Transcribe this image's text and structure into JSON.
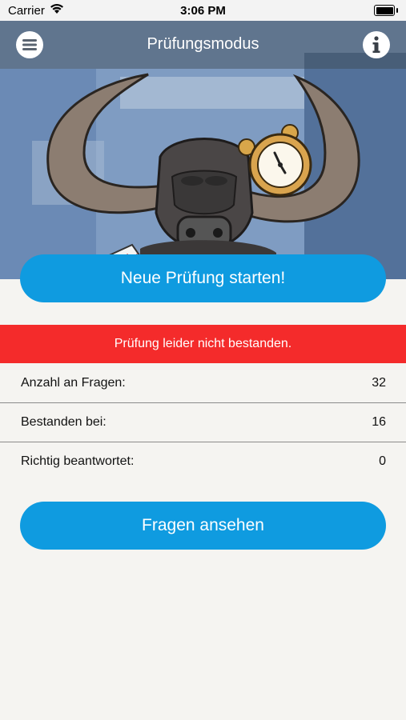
{
  "status_bar": {
    "carrier": "Carrier",
    "time": "3:06 PM"
  },
  "nav": {
    "title": "Prüfungsmodus",
    "menu_icon": "menu-icon",
    "info_icon": "info-icon"
  },
  "hero": {
    "illustration": "bull-mascot-with-alarm-clock"
  },
  "actions": {
    "start_label": "Neue Prüfung starten!",
    "view_label": "Fragen ansehen"
  },
  "result": {
    "message": "Prüfung leider nicht bestanden.",
    "color": "#f42b2b"
  },
  "stats": [
    {
      "label": "Anzahl an Fragen:",
      "value": "32"
    },
    {
      "label": "Bestanden bei:",
      "value": "16"
    },
    {
      "label": "Richtig beantwortet:",
      "value": "0"
    }
  ],
  "colors": {
    "accent": "#0f9be0",
    "background": "#f5f4f1"
  }
}
